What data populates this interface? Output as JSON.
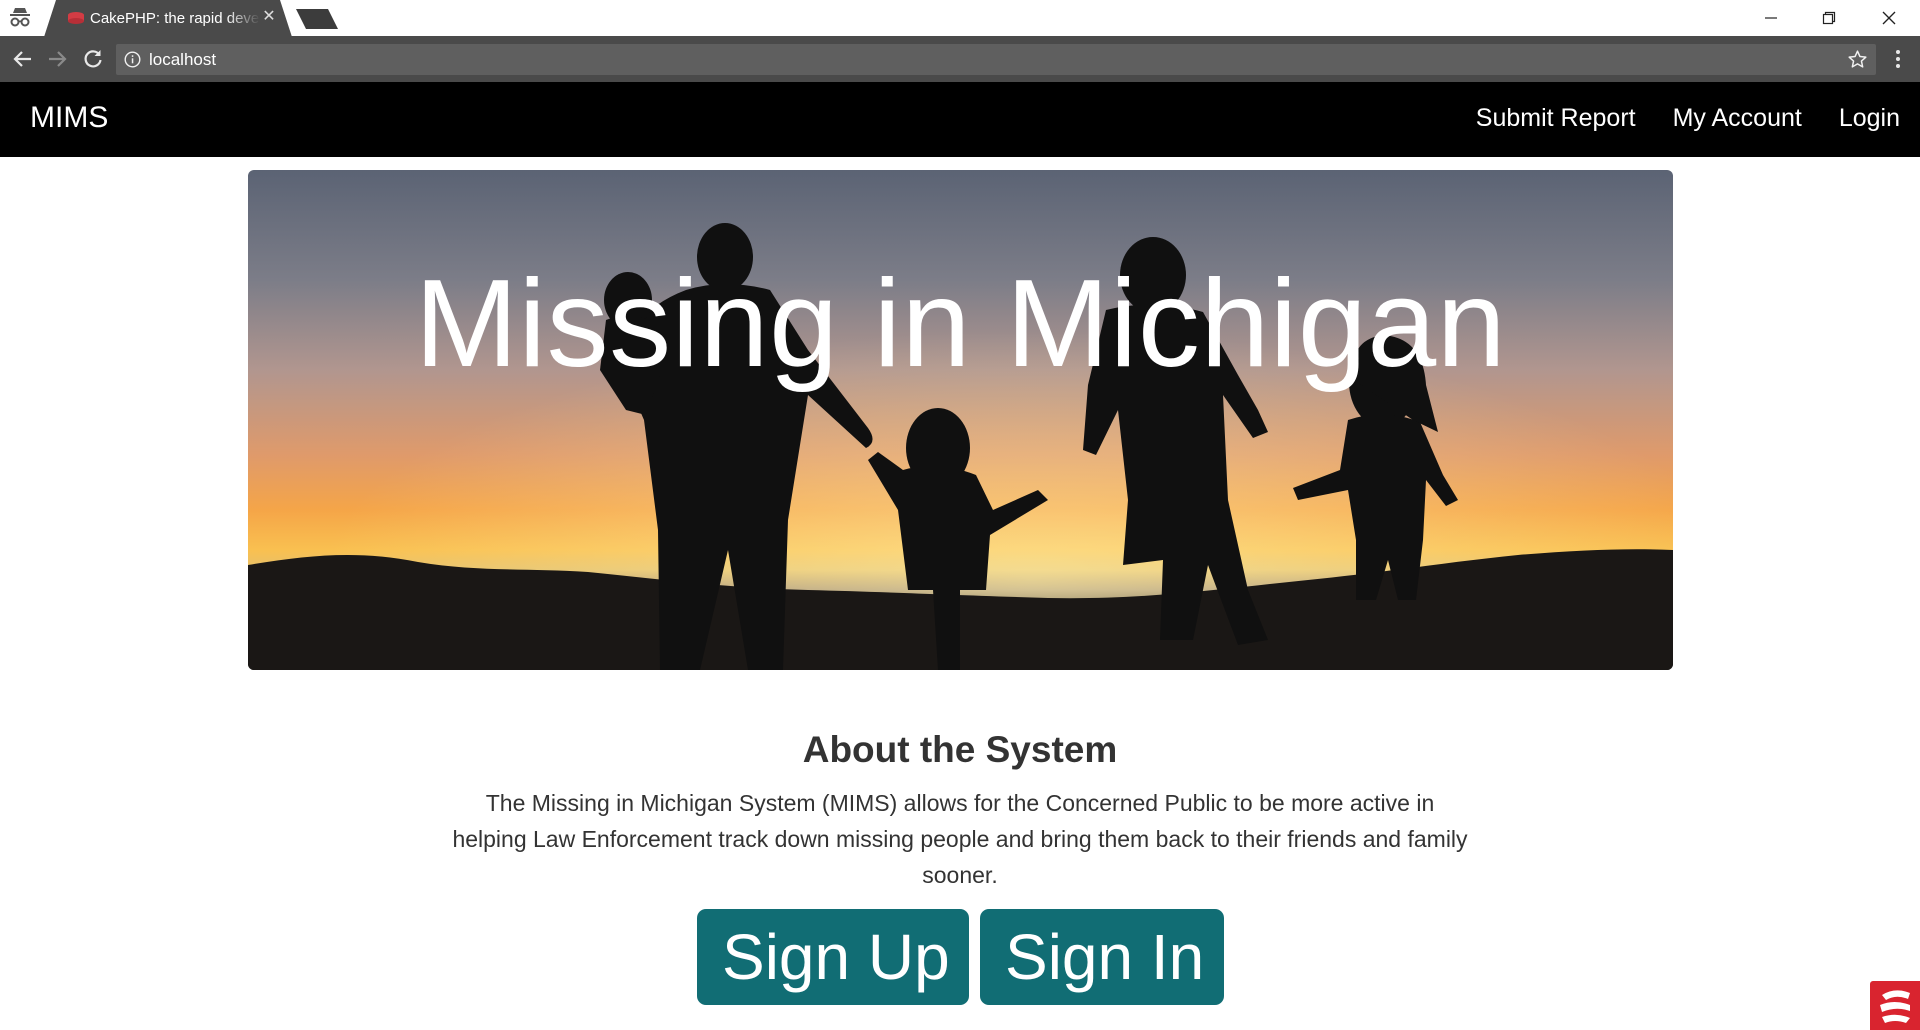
{
  "browser": {
    "tab": {
      "title": "CakePHP: the rapid development php framework"
    },
    "address_bar": {
      "url": "localhost"
    }
  },
  "navbar": {
    "brand": "MIMS",
    "links": [
      "Submit Report",
      "My Account",
      "Login"
    ]
  },
  "hero": {
    "title": "Missing in Michigan"
  },
  "about": {
    "heading": "About the System",
    "text": "The Missing in Michigan System (MIMS) allows for the Concerned Public to be more active in helping Law Enforcement track down missing people and bring them back to their friends and family sooner."
  },
  "buttons": {
    "sign_up": "Sign Up",
    "sign_in": "Sign In"
  },
  "colors": {
    "nav_background": "#000000",
    "button": "#116d74",
    "tab_bar": "#4a4a4a"
  },
  "icons": [
    "incognito-icon",
    "cakephp-favicon",
    "close-icon",
    "minimize-icon",
    "restore-icon",
    "back-icon",
    "forward-icon",
    "reload-icon",
    "info-icon",
    "star-icon",
    "menu-icon",
    "widget-icon"
  ]
}
